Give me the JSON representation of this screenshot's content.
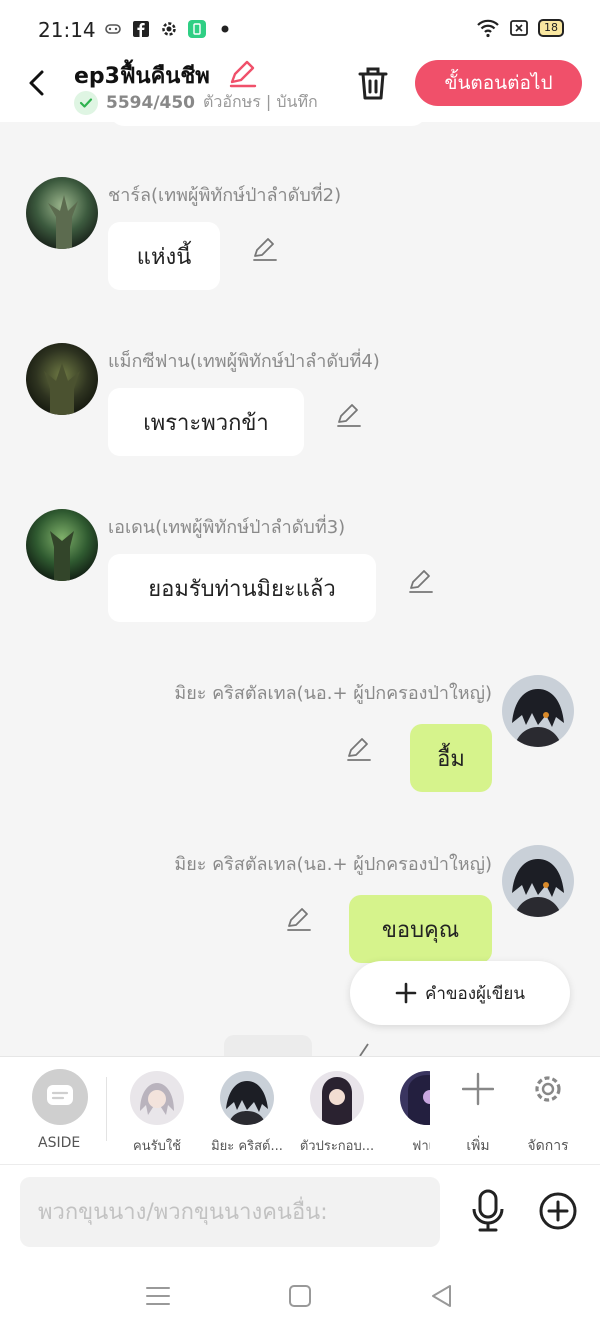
{
  "status": {
    "time": "21:14",
    "battery": "18"
  },
  "header": {
    "title": "ep3ฟื้นคืนชีพ",
    "char_count": "5594/450",
    "subtitle_rest": "ตัวอักษร | บันทึก",
    "next_label": "ขั้นตอนต่อไป"
  },
  "messages": [
    {
      "name": "ชาร์ล(เทพผู้พิทักษ์ป่าลำดับที่2)",
      "text": "แห่งนี้",
      "side": "left"
    },
    {
      "name": "แม็กซีฟาน(เทพผู้พิทักษ์ป่าลำดับที่4)",
      "text": "เพราะพวกข้า",
      "side": "left"
    },
    {
      "name": "เอเดน(เทพผู้พิทักษ์ป่าลำดับที่3)",
      "text": "ยอมรับท่านมิยะแล้ว",
      "side": "left"
    },
    {
      "name": "มิยะ คริสตัลเทล(นอ.+ ผู้ปกครองป่าใหญ่)",
      "text": "อื้ม",
      "side": "right"
    },
    {
      "name": "มิยะ คริสตัลเทล(นอ.+ ผู้ปกครองป่าใหญ่)",
      "text": "ขอบคุณ",
      "side": "right"
    }
  ],
  "fab": {
    "label": "คำของผู้เขียน"
  },
  "charbar": {
    "aside_label": "ASIDE",
    "characters": [
      "คนรับใช้",
      "มิยะ คริสต์...",
      "ตัวประกอบ...",
      "ฟาเคิ"
    ],
    "add_label": "เพิ่ม",
    "manage_label": "จัดการ"
  },
  "input": {
    "placeholder": "พวกขุนนาง/พวกขุนนางคนอื่น:"
  },
  "colors": {
    "accent": "#f0506a",
    "right_bubble": "#d6f38c",
    "background": "#f5f5f5"
  },
  "icons": [
    "back-arrow-icon",
    "edit-pencil-icon",
    "check-icon",
    "trash-icon",
    "edit-pen-icon",
    "plus-icon",
    "aside-chat-icon",
    "add-plus-icon",
    "gear-icon",
    "mic-icon",
    "add-circle-icon",
    "nav-menu-icon",
    "nav-home-icon",
    "nav-back-icon"
  ]
}
